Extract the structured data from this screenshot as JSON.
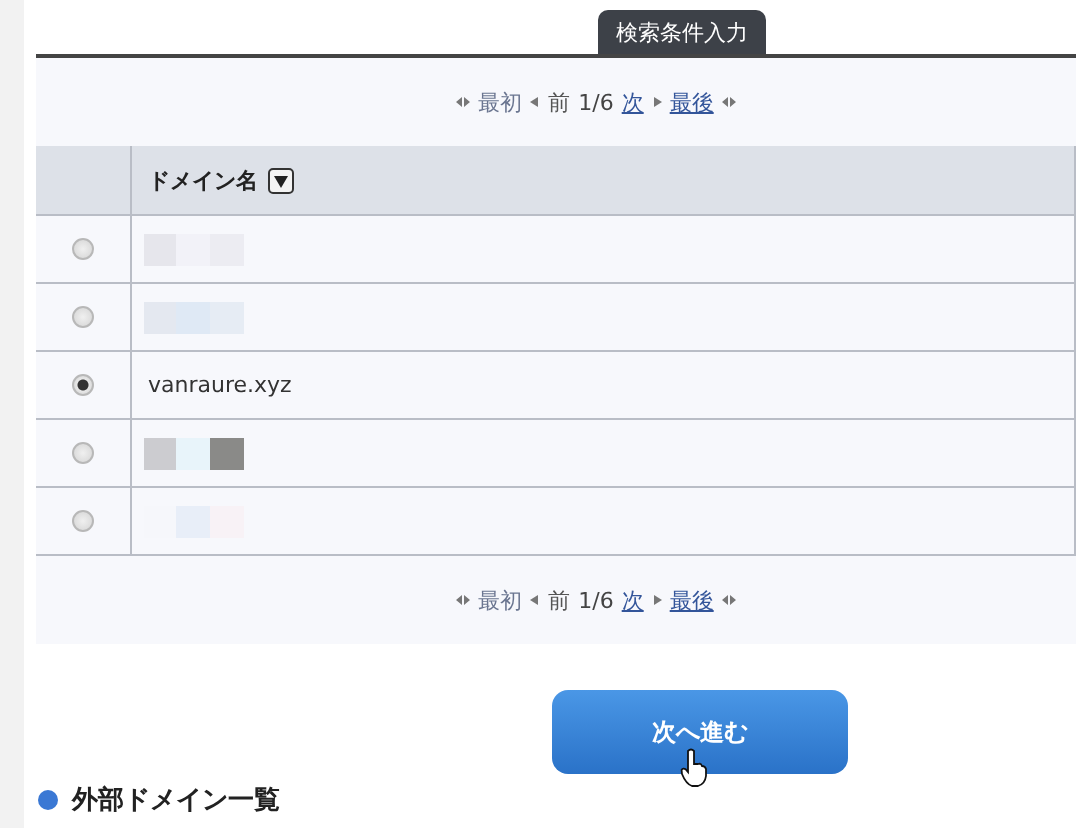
{
  "tab": {
    "label": "検索条件入力"
  },
  "pagers": [
    {
      "first": {
        "label": "最初",
        "disabled": true
      },
      "prev": {
        "label": "前",
        "disabled": true
      },
      "page": "1/6",
      "next": {
        "label": "次",
        "disabled": false
      },
      "last": {
        "label": "最後",
        "disabled": false
      }
    },
    {
      "first": {
        "label": "最初",
        "disabled": true
      },
      "prev": {
        "label": "前",
        "disabled": true
      },
      "page": "1/6",
      "next": {
        "label": "次",
        "disabled": false
      },
      "last": {
        "label": "最後",
        "disabled": false
      }
    }
  ],
  "table": {
    "columns": [
      {
        "label": "ドメイン名",
        "sortable": true
      }
    ],
    "rows": [
      {
        "kind": "redacted",
        "selected": false
      },
      {
        "kind": "redacted",
        "selected": false
      },
      {
        "kind": "text",
        "domain": "vanraure.xyz",
        "selected": true
      },
      {
        "kind": "redacted",
        "selected": false
      },
      {
        "kind": "redacted",
        "selected": false
      }
    ]
  },
  "next_button": {
    "label": "次へ進む"
  },
  "section_heading": {
    "label": "外部ドメイン一覧",
    "color": "#3a78d4"
  }
}
